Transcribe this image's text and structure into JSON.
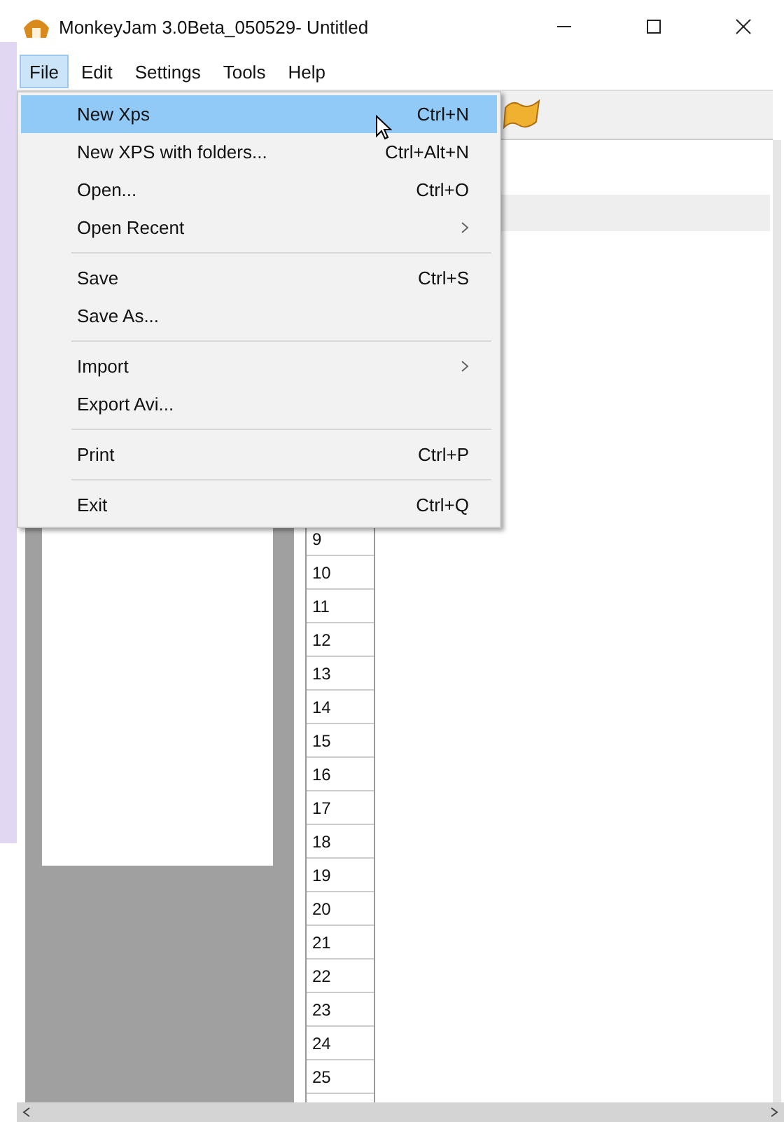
{
  "window": {
    "title": "MonkeyJam 3.0Beta_050529- Untitled"
  },
  "menubar": [
    {
      "label": "File",
      "selected": true
    },
    {
      "label": "Edit",
      "selected": false
    },
    {
      "label": "Settings",
      "selected": false
    },
    {
      "label": "Tools",
      "selected": false
    },
    {
      "label": "Help",
      "selected": false
    }
  ],
  "file_menu": [
    {
      "kind": "item",
      "label": "New Xps",
      "shortcut": "Ctrl+N",
      "selected": true
    },
    {
      "kind": "item",
      "label": "New XPS with folders...",
      "shortcut": "Ctrl+Alt+N",
      "selected": false
    },
    {
      "kind": "item",
      "label": "Open...",
      "shortcut": "Ctrl+O",
      "selected": false
    },
    {
      "kind": "item",
      "label": "Open Recent",
      "submenu": true,
      "selected": false
    },
    {
      "kind": "separator"
    },
    {
      "kind": "item",
      "label": "Save",
      "shortcut": "Ctrl+S",
      "selected": false
    },
    {
      "kind": "item",
      "label": "Save As...",
      "selected": false
    },
    {
      "kind": "separator"
    },
    {
      "kind": "item",
      "label": "Import",
      "submenu": true,
      "selected": false
    },
    {
      "kind": "item",
      "label": "Export Avi...",
      "selected": false
    },
    {
      "kind": "separator"
    },
    {
      "kind": "item",
      "label": "Print",
      "shortcut": "Ctrl+P",
      "selected": false
    },
    {
      "kind": "separator"
    },
    {
      "kind": "item",
      "label": "Exit",
      "shortcut": "Ctrl+Q",
      "selected": false
    }
  ],
  "frames": [
    "9",
    "10",
    "11",
    "12",
    "13",
    "14",
    "15",
    "16",
    "17",
    "18",
    "19",
    "20",
    "21",
    "22",
    "23",
    "24",
    "25"
  ]
}
